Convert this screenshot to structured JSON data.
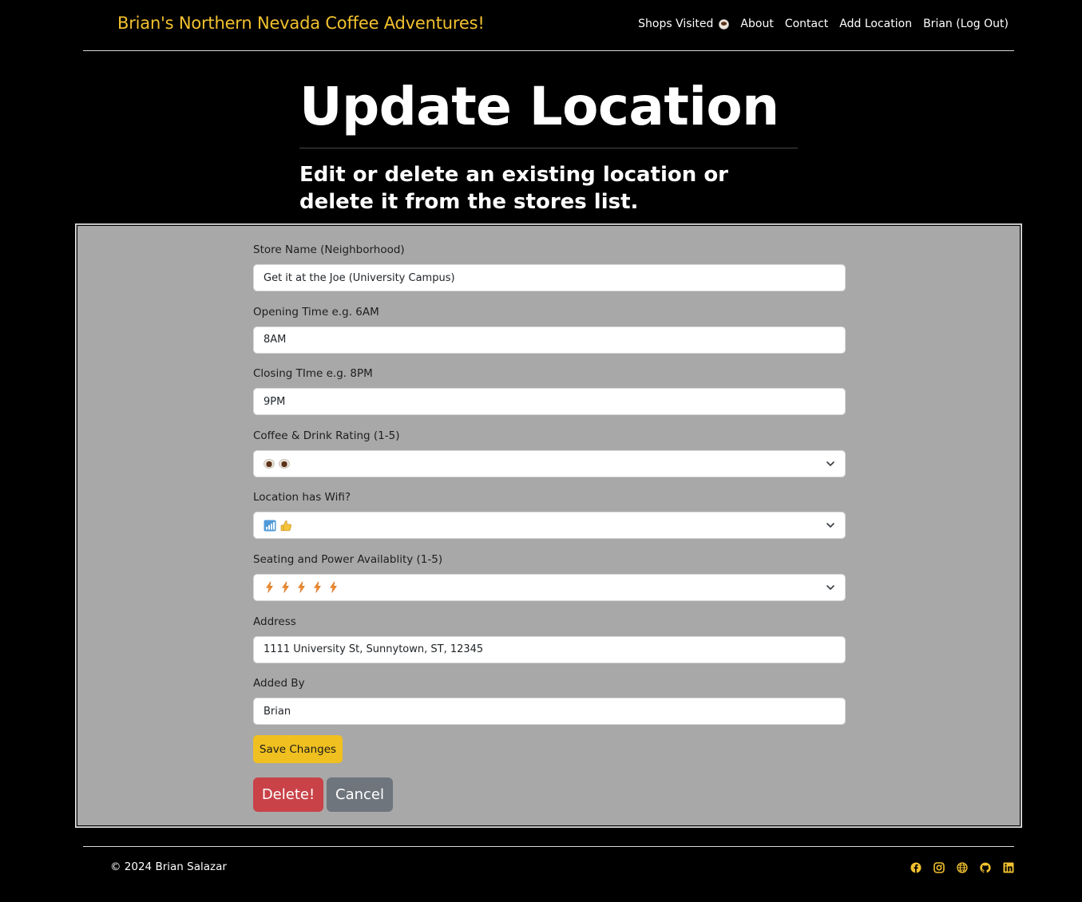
{
  "brand": "Brian's Northern Nevada Coffee Adventures!",
  "nav": {
    "shops_visited": "Shops Visited",
    "about": "About",
    "contact": "Contact",
    "add_location": "Add Location",
    "logout": "Brian (Log Out)"
  },
  "page": {
    "title": "Update Location",
    "subtitle": "Edit or delete an existing location or delete it from the stores list."
  },
  "form": {
    "store_name": {
      "label": "Store Name (Neighborhood)",
      "value": "Get it at the Joe (University Campus)"
    },
    "opening_time": {
      "label": "Opening Time e.g. 6AM",
      "value": "8AM"
    },
    "closing_time": {
      "label": "Closing TIme e.g. 8PM",
      "value": "9PM"
    },
    "coffee_rating": {
      "label": "Coffee & Drink Rating (1-5)",
      "value": 2,
      "icon": "coffee-cup-icon"
    },
    "wifi": {
      "label": "Location has Wifi?",
      "value": "yes",
      "icons": [
        "antenna-bars-icon",
        "thumbs-up-icon"
      ]
    },
    "power_rating": {
      "label": "Seating and Power Availablity (1-5)",
      "value": 5,
      "icon": "lightning-bolt-icon"
    },
    "address": {
      "label": "Address",
      "value": "1111 University St, Sunnytown, ST, 12345"
    },
    "added_by": {
      "label": "Added By",
      "value": "Brian"
    }
  },
  "buttons": {
    "save": "Save Changes",
    "delete": "Delete!",
    "cancel": "Cancel"
  },
  "footer": {
    "copyright": "© 2024 Brian Salazar",
    "social": [
      "facebook-icon",
      "instagram-icon",
      "globe-icon",
      "github-icon",
      "linkedin-icon"
    ]
  },
  "colors": {
    "background": "#000000",
    "brand": "#f2c12e",
    "panel": "#a8a8a8",
    "save": "#f0c020",
    "delete": "#c94248",
    "cancel": "#6e757d",
    "social": "#f2c12e"
  }
}
